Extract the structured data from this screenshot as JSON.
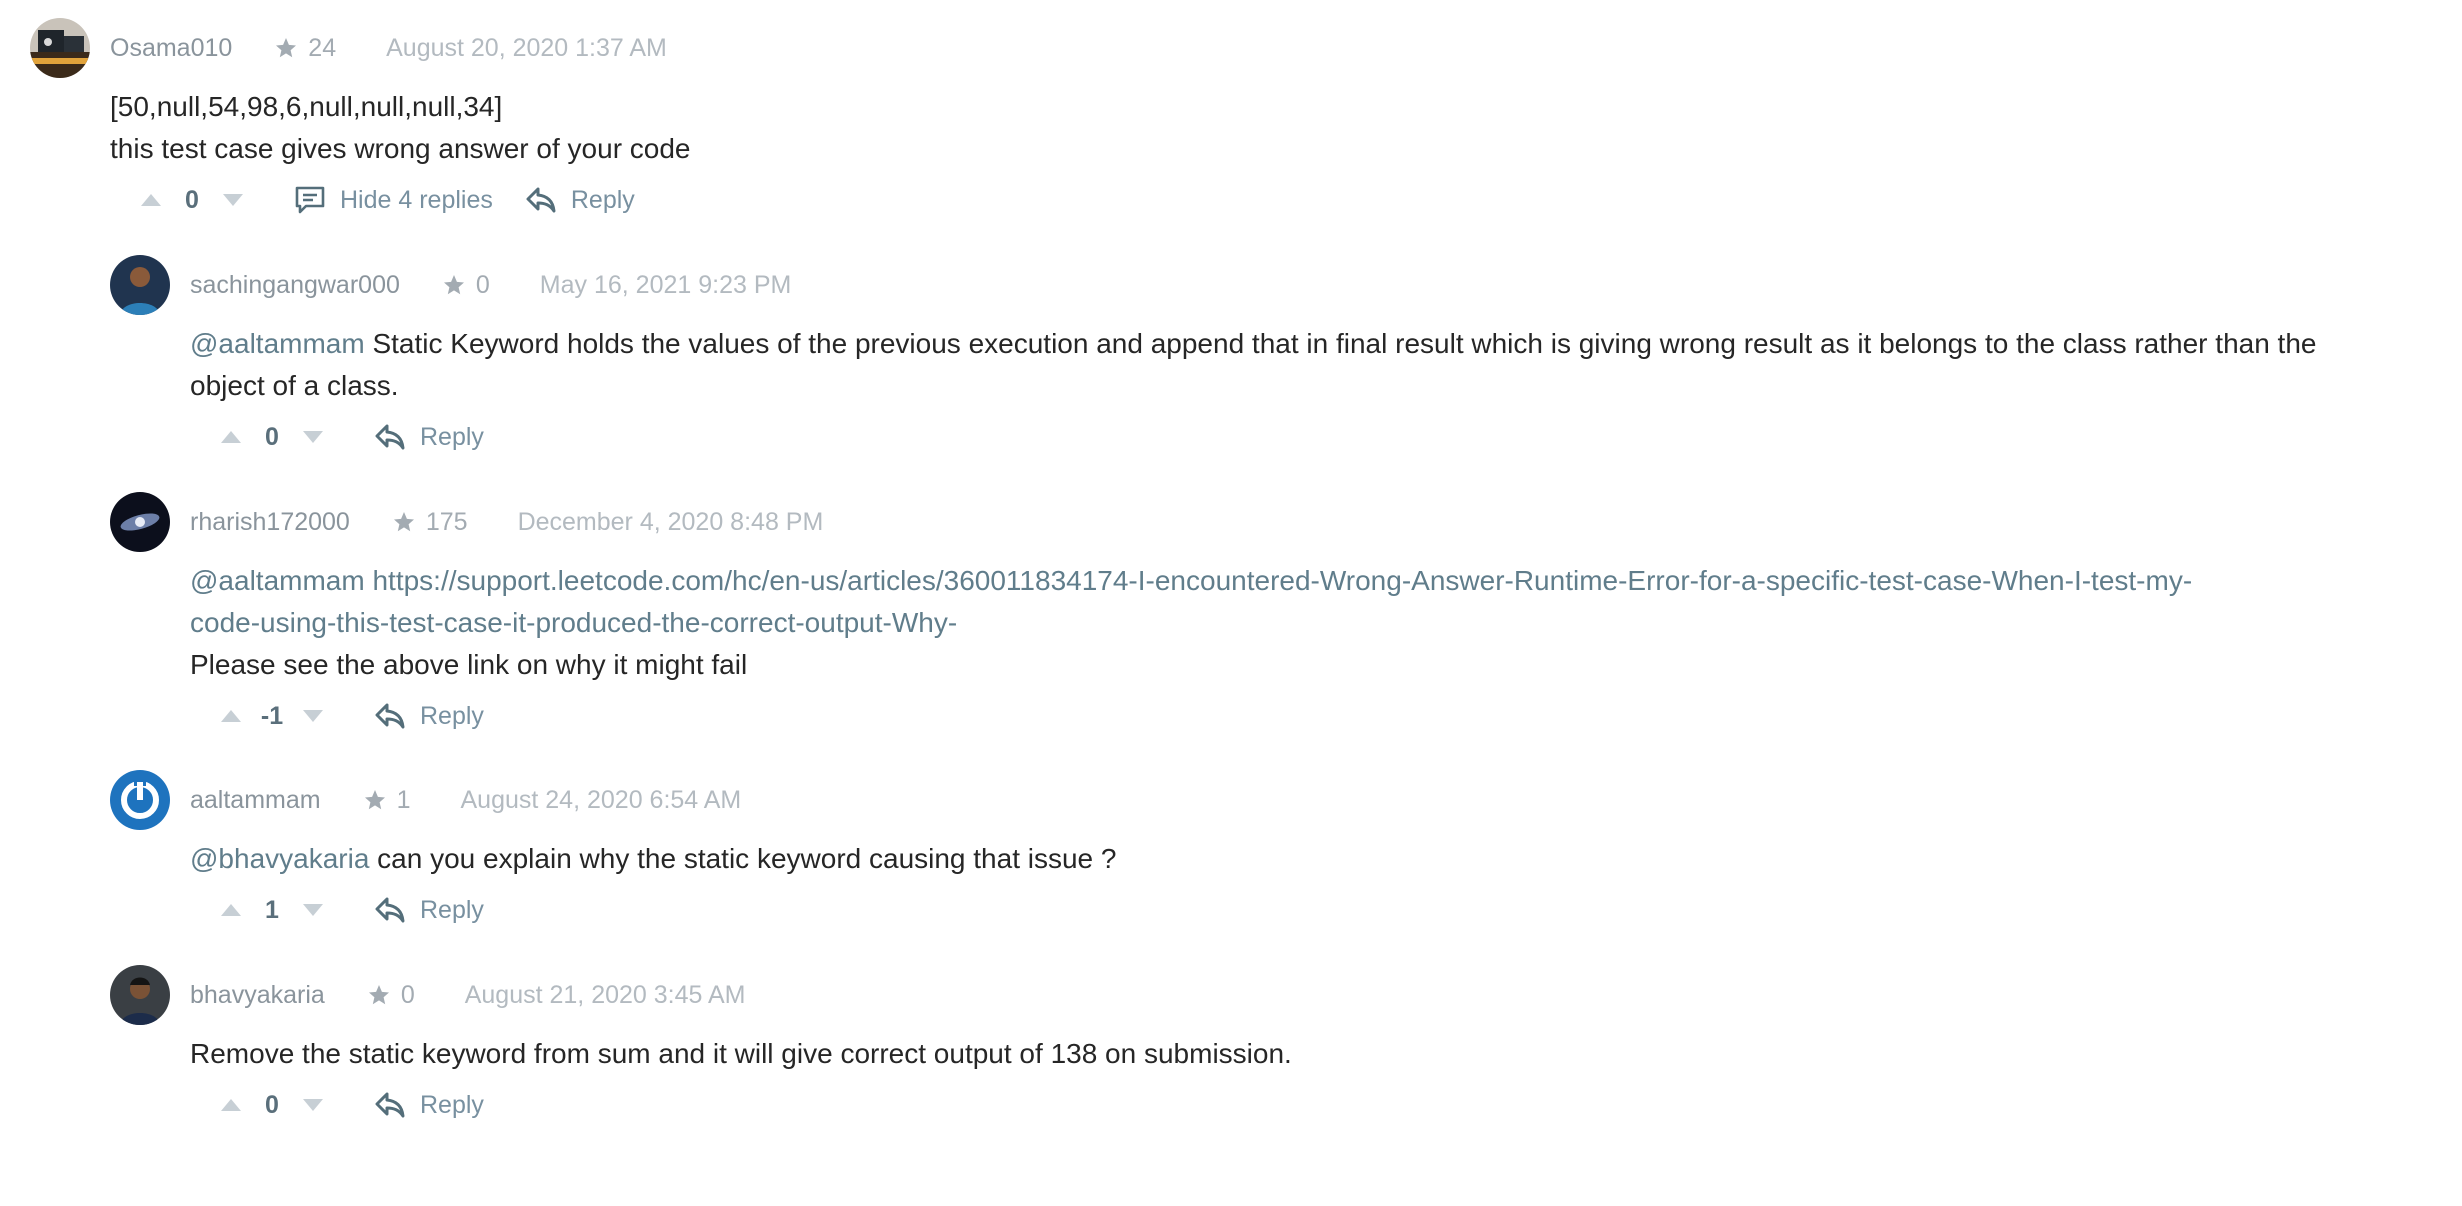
{
  "comments": [
    {
      "username": "Osama010",
      "reputation": "24",
      "date": "August 20, 2020 1:37 AM",
      "lines": [
        "[50,null,54,98,6,null,null,null,34]",
        "this test case gives wrong answer of your code"
      ],
      "votes": "0",
      "hide_replies_label": "Hide 4 replies",
      "reply_label": "Reply"
    },
    {
      "username": "sachingangwar000",
      "reputation": "0",
      "date": "May 16, 2021 9:23 PM",
      "mention": "@aaltammam",
      "text_line1": " Static Keyword holds the values of the previous execution and append that in final result which is giving wrong result as it belongs to the class rather than the",
      "text_line2": "object of a class.",
      "votes": "0",
      "reply_label": "Reply"
    },
    {
      "username": "rharish172000",
      "reputation": "175",
      "date": "December 4, 2020 8:48 PM",
      "mention": "@aaltammam",
      "link_line1": " https://support.leetcode.com/hc/en-us/articles/360011834174-I-encountered-Wrong-Answer-Runtime-Error-for-a-specific-test-case-When-I-test-my-",
      "link_line2": "code-using-this-test-case-it-produced-the-correct-output-Why-",
      "text_line3": "Please see the above link on why it might fail",
      "votes": "-1",
      "reply_label": "Reply"
    },
    {
      "username": "aaltammam",
      "reputation": "1",
      "date": "August 24, 2020 6:54 AM",
      "mention": "@bhavyakaria",
      "text_line1": " can you explain why the static keyword causing that issue ?",
      "votes": "1",
      "reply_label": "Reply"
    },
    {
      "username": "bhavyakaria",
      "reputation": "0",
      "date": "August 21, 2020 3:45 AM",
      "text_line1": "Remove the static keyword from sum and it will give correct output of 138 on submission.",
      "votes": "0",
      "reply_label": "Reply"
    }
  ],
  "colors": {
    "mention": "#607d8b",
    "meta": "#8a949c",
    "action": "#7890a0"
  }
}
